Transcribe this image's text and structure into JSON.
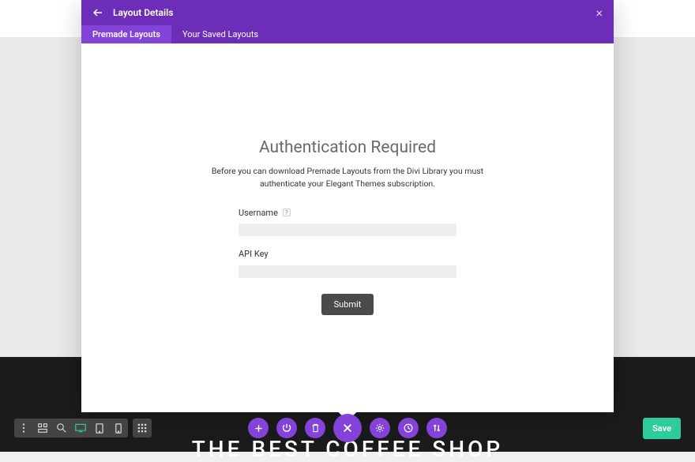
{
  "modal": {
    "title": "Layout Details",
    "tabs": [
      {
        "label": "Premade Layouts",
        "active": true
      },
      {
        "label": "Your Saved Layouts",
        "active": false
      }
    ],
    "auth": {
      "heading": "Authentication Required",
      "description": "Before you can download Premade Layouts from the Divi Library you must authenticate your Elegant Themes subscription.",
      "username_label": "Username",
      "apikey_label": "API Key",
      "submit_label": "Submit"
    }
  },
  "bottom": {
    "save_label": "Save"
  },
  "background": {
    "headline": "THE BEST COFFEE SHOP"
  }
}
